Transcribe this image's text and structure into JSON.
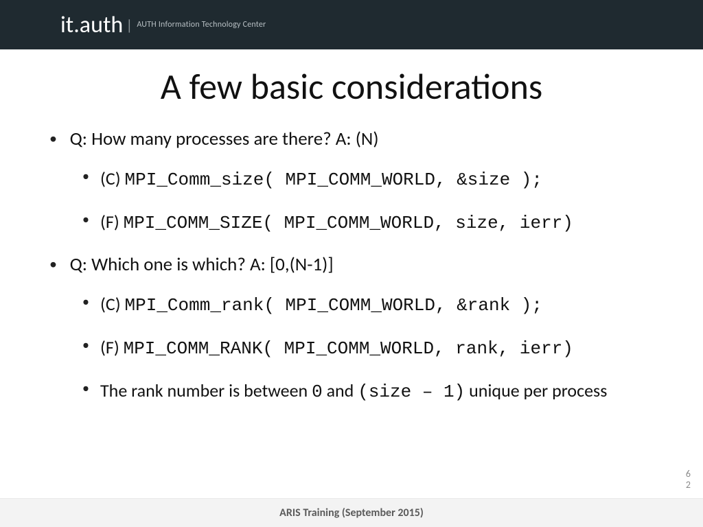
{
  "header": {
    "logo_it": "it",
    "logo_dot": ".",
    "logo_auth": "auth",
    "logo_sep": "|",
    "logo_subtitle": "AUTH Information Technology Center"
  },
  "title": "A few basic considerations",
  "bullets": {
    "q1": "Q: How many processes are there? A: (N)",
    "q1_c_tag": "(C) ",
    "q1_c_code": "MPI_Comm_size( MPI_COMM_WORLD, &size );",
    "q1_f_tag": "(F) ",
    "q1_f_code": "MPI_COMM_SIZE( MPI_COMM_WORLD, size, ierr)",
    "q2": "Q: Which one is which? A: [0,(N-1)]",
    "q2_c_tag": "(C) ",
    "q2_c_code": "MPI_Comm_rank( MPI_COMM_WORLD, &rank );",
    "q2_f_tag": "(F) ",
    "q2_f_code": "MPI_COMM_RANK( MPI_COMM_WORLD, rank, ierr)",
    "q2_note_pre": "The rank number is between ",
    "q2_note_code1": "0",
    "q2_note_mid": " and ",
    "q2_note_code2": "(size – 1)",
    "q2_note_post": " unique per process"
  },
  "page_number_top": "6",
  "page_number_bottom": "2",
  "footer": "ARIS Training (September 2015)"
}
